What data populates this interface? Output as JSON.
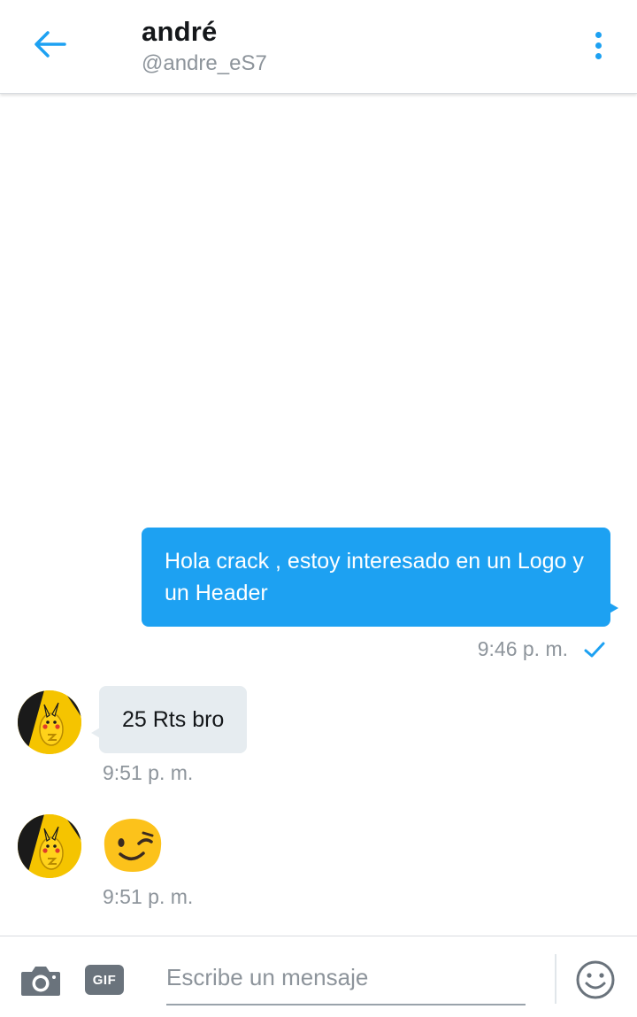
{
  "header": {
    "name": "andré",
    "handle": "@andre_eS7",
    "back_icon": "arrow-left-icon",
    "more_icon": "more-vertical-icon",
    "accent": "#1da1f2"
  },
  "messages": [
    {
      "direction": "outgoing",
      "text": "Hola crack , estoy interesado en un Logo y un Header",
      "time": "9:46 p. m.",
      "status_icon": "checkmark-icon"
    },
    {
      "direction": "incoming",
      "text": "25 Rts bro",
      "time": "9:51 p. m."
    },
    {
      "direction": "incoming",
      "emoji": "winking-face-emoji",
      "time": "9:51 p. m."
    }
  ],
  "composer": {
    "placeholder": "Escribe un mensaje",
    "gif_label": "GIF",
    "camera_icon": "camera-icon",
    "emoji_icon": "smiley-icon"
  },
  "colors": {
    "outgoing_bubble": "#1da1f2",
    "incoming_bubble": "#e6ecf0",
    "secondary_text": "#8d949b"
  }
}
